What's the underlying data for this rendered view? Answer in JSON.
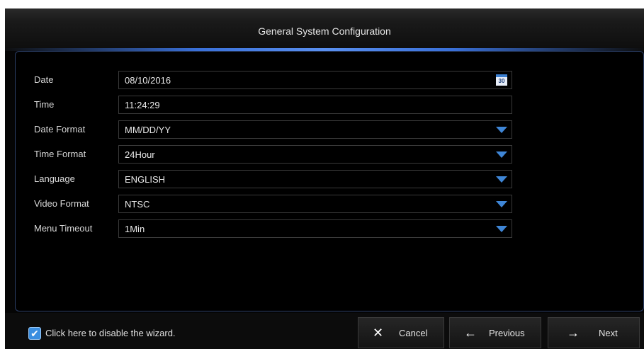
{
  "dialog": {
    "title": "General System Configuration"
  },
  "fields": [
    {
      "label": "Date",
      "value": "08/10/2016",
      "control": "date",
      "icon": "calendar-icon",
      "icon_text": "30"
    },
    {
      "label": "Time",
      "value": "11:24:29",
      "control": "text"
    },
    {
      "label": "Date Format",
      "value": "MM/DD/YY",
      "control": "dropdown"
    },
    {
      "label": "Time Format",
      "value": "24Hour",
      "control": "dropdown"
    },
    {
      "label": "Language",
      "value": "ENGLISH",
      "control": "dropdown"
    },
    {
      "label": "Video Format",
      "value": "NTSC",
      "control": "dropdown"
    },
    {
      "label": "Menu Timeout",
      "value": "1Min",
      "control": "dropdown"
    }
  ],
  "footer": {
    "wizard_checkbox": {
      "checked": true,
      "label": "Click here to disable the wizard."
    },
    "buttons": {
      "cancel": {
        "label": "Cancel",
        "icon": "close-icon"
      },
      "previous": {
        "label": "Previous",
        "icon": "arrow-left-icon"
      },
      "next": {
        "label": "Next",
        "icon": "arrow-right-icon"
      }
    }
  },
  "colors": {
    "accent": "#3f86d6",
    "background": "#050505",
    "panel_border": "#2b3e66"
  }
}
